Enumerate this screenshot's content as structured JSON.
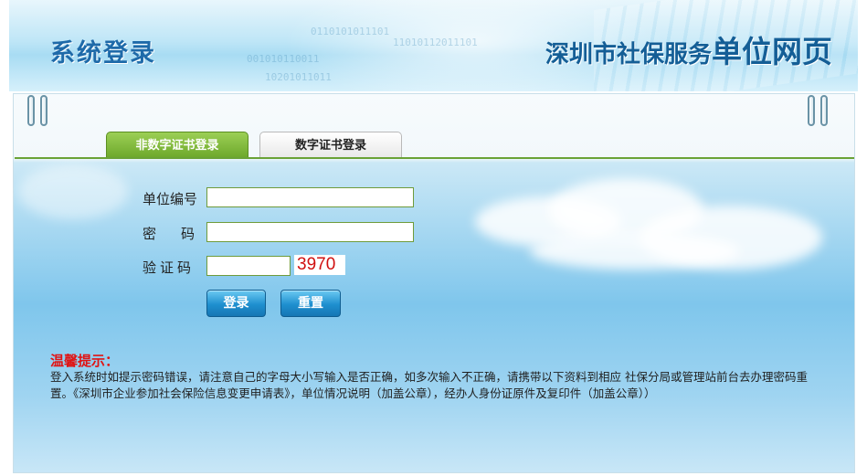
{
  "header": {
    "left_title": "系统登录",
    "right_title_part1": "深圳市社保服务",
    "right_title_part2": "单位网页",
    "binary_text_1": "0110101011101",
    "binary_text_2": "11010112011101",
    "binary_text_3": "001010110011",
    "binary_text_4": "10201011011"
  },
  "tabs": [
    {
      "label": "非数字证书登录",
      "active": true
    },
    {
      "label": "数字证书登录",
      "active": false
    }
  ],
  "form": {
    "unit_code_label": "单位编号",
    "unit_code_value": "",
    "password_label": "密　码",
    "password_value": "",
    "captcha_label": "验证码",
    "captcha_value": "",
    "captcha_code": "3970",
    "login_button": "登录",
    "reset_button": "重置"
  },
  "tips": {
    "title": "温馨提示：",
    "text": "登入系统时如提示密码错误，请注意自己的字母大小写输入是否正确，如多次输入不正确，请携带以下资料到相应 社保分局或管理站前台去办理密码重置。《深圳市企业参加社会保险信息变更申请表》，单位情况说明（加盖公章），经办人身份证原件及复印件（加盖公章））"
  },
  "colors": {
    "tab_active": "#7ab534",
    "title_blue": "#1e6aa9",
    "tip_red": "#e01414",
    "captcha_red": "#d01010",
    "button_blue": "#1e8fcf"
  }
}
